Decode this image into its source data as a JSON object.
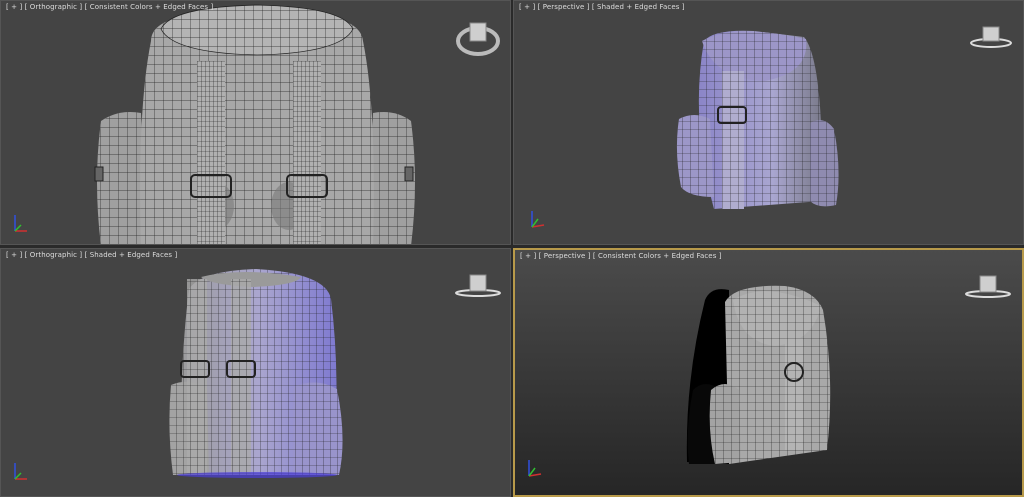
{
  "viewports": [
    {
      "label": "[ + ] [ Orthographic ] [ Consistent Colors + Edged Faces ]",
      "active": false
    },
    {
      "label": "[ + ] [ Perspective ] [ Shaded + Edged Faces ]",
      "active": false
    },
    {
      "label": "[ + ] [ Orthographic ] [ Shaded + Edged Faces ]",
      "active": false
    },
    {
      "label": "[ + ] [ Perspective ] [ Consistent Colors + Edged Faces ]",
      "active": true
    }
  ],
  "colors": {
    "viewport_bg": "#444444",
    "active_border": "#b89a4a",
    "mesh_gray": "#a9a9a9",
    "mesh_purple": "#8f88c8",
    "wire": "#1e1e1e",
    "axis_x": "#d03030",
    "axis_y": "#30c030",
    "axis_z": "#3050e0"
  },
  "icons": [
    "viewcube-icon",
    "axis-tripod-icon"
  ]
}
